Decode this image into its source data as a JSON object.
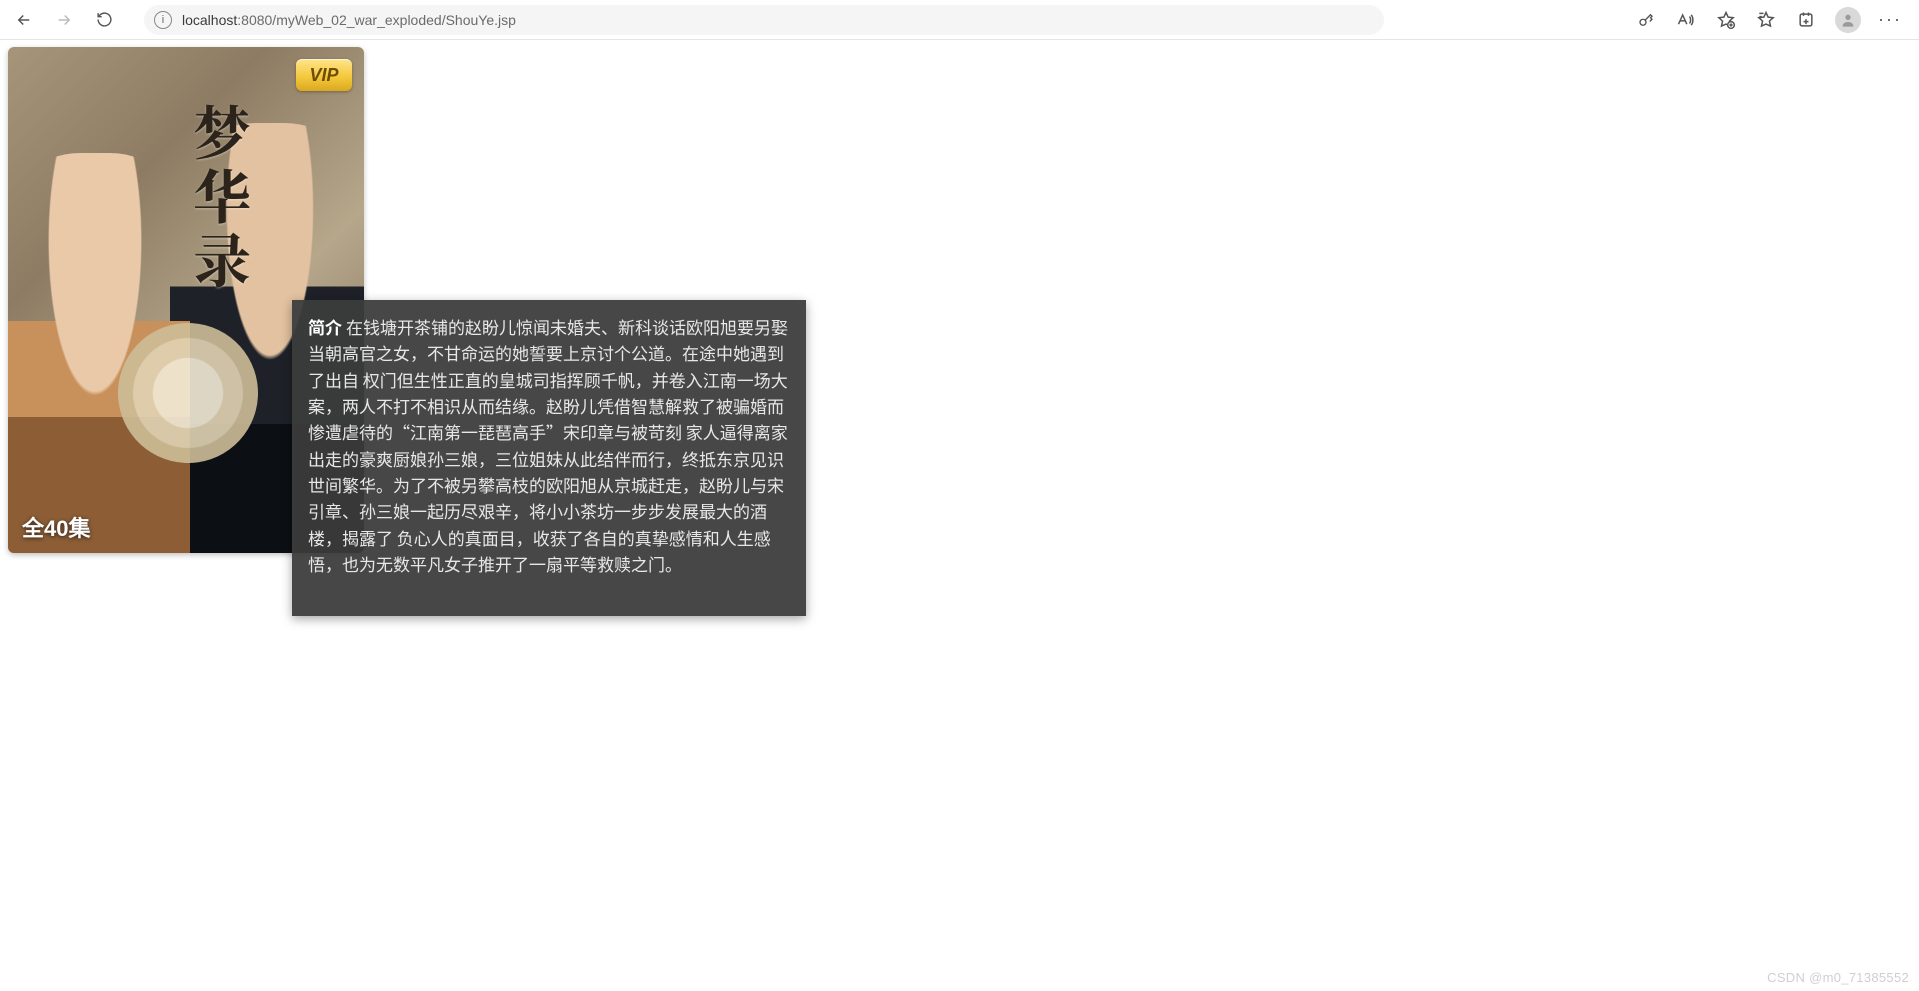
{
  "browser": {
    "url_host": "localhost",
    "url_path": ":8080/myWeb_02_war_exploded/ShouYe.jsp"
  },
  "poster": {
    "vip_label": "VIP",
    "title": "梦华录",
    "episodes": "全40集"
  },
  "synopsis": {
    "label": "简介",
    "text": "在钱塘开茶铺的赵盼儿惊闻未婚夫、新科谈话欧阳旭要另娶当朝高官之女，不甘命运的她誓要上京讨个公道。在途中她遇到了出自 权门但生性正直的皇城司指挥顾千帆，并卷入江南一场大案，两人不打不相识从而结缘。赵盼儿凭借智慧解救了被骗婚而惨遭虐待的“江南第一琵琶高手”宋印章与被苛刻 家人逼得离家出走的豪爽厨娘孙三娘，三位姐妹从此结伴而行，终抵东京见识世间繁华。为了不被另攀高枝的欧阳旭从京城赶走，赵盼儿与宋引章、孙三娘一起历尽艰辛，将小小茶坊一步步发展最大的酒楼，揭露了 负心人的真面目，收获了各自的真挚感情和人生感悟，也为无数平凡女子推开了一扇平等救赎之门。"
  },
  "watermark": "CSDN @m0_71385552"
}
